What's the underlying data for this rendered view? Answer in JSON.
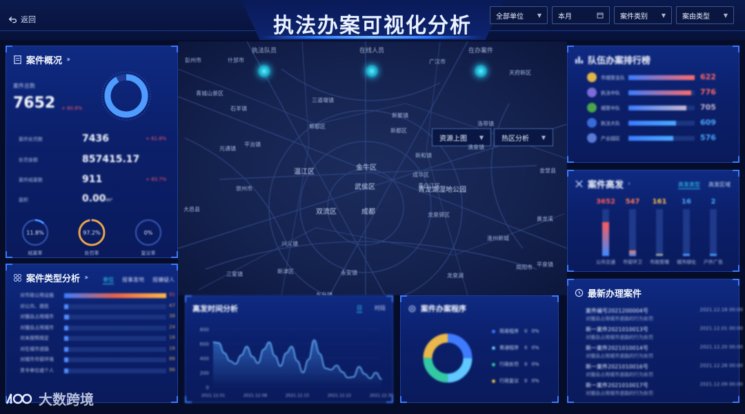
{
  "header": {
    "back_label": "返回",
    "title": "执法办案可视化分析",
    "filters": [
      {
        "label": "全部单位",
        "icon": "chevron-down-icon"
      },
      {
        "label": "本月",
        "icon": "calendar-icon"
      },
      {
        "label": "案件类别",
        "icon": "chevron-down-icon"
      },
      {
        "label": "案由类型",
        "icon": "chevron-down-icon"
      }
    ]
  },
  "map": {
    "stats": [
      "执法队员",
      "在线人员",
      "在办案件"
    ],
    "buttons": [
      "资源上图",
      "热区分析"
    ],
    "places": [
      "彭州市",
      "什邡市",
      "广汉市",
      "青城山景区",
      "石羊镇",
      "三道堰镇",
      "新繁镇",
      "新都区",
      "郫都区",
      "新和镇",
      "元通镇",
      "平治镇",
      "温江区",
      "金牛区",
      "成华区",
      "青白江区",
      "崇州市",
      "武侯区",
      "青龙湖湿地公园",
      "双流区",
      "成都",
      "龙泉驿区",
      "大邑县",
      "简阳市",
      "新津区",
      "兴义镇",
      "永安镇",
      "天府新区",
      "金堂县",
      "洛带镇",
      "清泉镇",
      "淮州新城",
      "三星镇",
      "黄龙溪",
      "东升镇",
      "龙泉湖",
      "平泉镇"
    ]
  },
  "overview": {
    "title": "案件概况",
    "total_label": "案件总数",
    "total_value": "7652",
    "total_change": "+ 60.8%",
    "rows": [
      {
        "label": "案件处罚数",
        "value": "7436",
        "change": "+ 61.8%"
      },
      {
        "label": "处罚金额",
        "value": "857415.17",
        "change": ""
      },
      {
        "label": "案件结案数",
        "value": "911",
        "change": "+ 83.7%"
      },
      {
        "label": "面积",
        "value": "0.00",
        "unit": "m²",
        "change": ""
      }
    ],
    "ring_pct": 0.92,
    "gauges": [
      {
        "value": "11.8%",
        "label": "结案率",
        "pct": 0.118,
        "color": "#3f8bff"
      },
      {
        "value": "97.2%",
        "label": "处罚率",
        "pct": 0.972,
        "color": "#e8a24a"
      },
      {
        "value": "0%",
        "label": "复议率",
        "pct": 0.0,
        "color": "#4fa0ff"
      }
    ]
  },
  "ranking": {
    "title": "队伍办案排行榜",
    "items": [
      {
        "name": "市城管支队",
        "value": "622",
        "pct": 1.0,
        "color": "#ff6b6b",
        "avatar": "#e0b64a"
      },
      {
        "name": "执法中队",
        "value": "776",
        "pct": 0.95,
        "color": "#ff6b6b",
        "avatar": "#7c6bd8"
      },
      {
        "name": "城管中队",
        "value": "705",
        "pct": 0.88,
        "color": "#c8b7d0",
        "avatar": "#4aa64a"
      },
      {
        "name": "执法大队",
        "value": "609",
        "pct": 0.72,
        "color": "#4aa8ff",
        "avatar": "#3a6ad8"
      },
      {
        "name": "产业园区",
        "value": "576",
        "pct": 0.68,
        "color": "#4aa8ff",
        "avatar": "#5a7ad8"
      }
    ]
  },
  "hotspot": {
    "title": "案件高发",
    "tabs": [
      "高发类型",
      "高发区域"
    ],
    "bars": [
      {
        "value": "3652",
        "label": "公共交通",
        "pct": 0.72,
        "color": "#ff5a5a"
      },
      {
        "value": "547",
        "label": "市容环卫",
        "pct": 0.12,
        "color": "#ff7a5a"
      },
      {
        "value": "161",
        "label": "市政管理",
        "pct": 0.04,
        "color": "#ffc14a"
      },
      {
        "value": "16",
        "label": "城市绿化",
        "pct": 0.01,
        "color": "#4fa8ff"
      },
      {
        "value": "2",
        "label": "户外广告",
        "pct": 0.005,
        "color": "#4fa8ff"
      }
    ]
  },
  "types": {
    "title": "案件类型分析",
    "tabs": [
      "单位",
      "按事发地",
      "按嫌疑人"
    ],
    "items": [
      {
        "name": "对市政公用设施",
        "value": "91",
        "pct": 1.0
      },
      {
        "name": "对公共、居民",
        "value": "47",
        "pct": 0.04
      },
      {
        "name": "对擅自占用城市",
        "value": "38",
        "pct": 0.05
      },
      {
        "name": "对擅自占用城市",
        "value": "24",
        "pct": 0.03
      },
      {
        "name": "对未按照规定",
        "value": "16",
        "pct": 0.03
      },
      {
        "name": "对在城市道路",
        "value": "16",
        "pct": 0.02
      },
      {
        "name": "对城市市容环境",
        "value": "86",
        "pct": 0.02
      },
      {
        "name": "责令单位或个人",
        "value": "96",
        "pct": 0.02
      }
    ]
  },
  "timeline": {
    "title": "高发时间分析",
    "tabs": [
      "日",
      "时段"
    ],
    "y_ticks": [
      "800",
      "600",
      "400",
      "200",
      "0"
    ],
    "x_ticks": [
      "2021.12.01",
      "2021.12.08",
      "2021.12.15",
      "2021.12.22",
      "2021.12.30"
    ]
  },
  "process": {
    "title": "案件办案程序",
    "legend": [
      {
        "label": "简易程序",
        "value": "0",
        "pct": "0%",
        "color": "#3f7bff"
      },
      {
        "label": "普通程序",
        "value": "0",
        "pct": "0%",
        "color": "#5ec8ff"
      },
      {
        "label": "行政处罚",
        "value": "0",
        "pct": "0%",
        "color": "#32c9a4"
      },
      {
        "label": "行政复议",
        "value": "0",
        "pct": "0%",
        "color": "#e8b84a"
      }
    ]
  },
  "latest": {
    "title": "最新办理案件",
    "items": [
      {
        "no": "案件编号2021200004号",
        "desc": "对擅自占用城市道路的行为处罚",
        "date": "2021.12.18 00:00"
      },
      {
        "no": "新一案件2021010013号",
        "desc": "对擅自占用城市道路的行为处罚",
        "date": "2021.12.01 00:00"
      },
      {
        "no": "新一案件2021010014号",
        "desc": "对擅自占用城市道路的行为处罚",
        "date": "2021.12.20 00:00"
      },
      {
        "no": "新一案件2021010016号",
        "desc": "对擅自占用城市道路的行为处罚",
        "date": "2021.12.28 00:00"
      },
      {
        "no": "新一案件2021010017号",
        "desc": "对擅自占用城市道路的行为处罚",
        "date": "2021.12.09 00:00"
      }
    ]
  },
  "watermark": "大数跨境",
  "chart_data": [
    {
      "type": "line",
      "title": "高发时间分析",
      "x": [
        "2021.12.01",
        "2021.12.08",
        "2021.12.15",
        "2021.12.22",
        "2021.12.30"
      ],
      "ylim": [
        0,
        800
      ],
      "series": [
        {
          "values": [
            620,
            610,
            470,
            360,
            320,
            440,
            560,
            420,
            330,
            520,
            620,
            430,
            290,
            470,
            560,
            360,
            200,
            380,
            650,
            460,
            260,
            240,
            300,
            210,
            130,
            140,
            280,
            180,
            120,
            200,
            110
          ]
        }
      ]
    },
    {
      "type": "pie",
      "title": "案件办案程序",
      "categories": [
        "简易程序",
        "普通程序",
        "行政处罚",
        "行政复议"
      ],
      "values": [
        25,
        25,
        25,
        25
      ]
    }
  ]
}
